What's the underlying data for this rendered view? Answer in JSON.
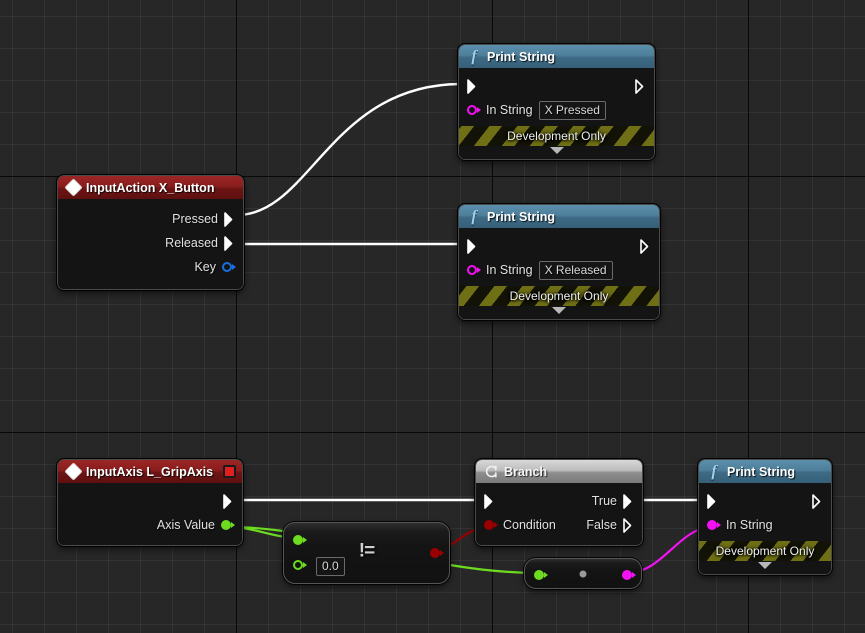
{
  "app": {
    "context": "unreal-engine-blueprint-event-graph",
    "canvas_bg": "#272727",
    "grid_minor": "#323232",
    "grid_major": "#000000"
  },
  "palette": {
    "exec_wire": "#ffffff",
    "string_pin": "#f312f3",
    "bool_pin": "#9b0000",
    "float_pin": "#6ddb20",
    "struct_pin": "#1a6fe0",
    "event_header": "#8a1d1d",
    "function_header": "#4e7f9b",
    "flow_header": "#bdbdbd",
    "dev_only_stripe": "#6f6f16"
  },
  "nodes": {
    "input_action": {
      "title": "InputAction X_Button",
      "icon": "event-diamond-icon",
      "pins": [
        {
          "label": "Pressed",
          "type": "exec",
          "dir": "out"
        },
        {
          "label": "Released",
          "type": "exec",
          "dir": "out"
        },
        {
          "label": "Key",
          "type": "struct",
          "dir": "out"
        }
      ]
    },
    "print_string_pressed": {
      "title": "Print String",
      "icon": "function-f-icon",
      "in_string_label": "In String",
      "in_string_value": "X Pressed",
      "footer": "Development Only"
    },
    "print_string_released": {
      "title": "Print String",
      "icon": "function-f-icon",
      "in_string_label": "In String",
      "in_string_value": "X Released",
      "footer": "Development Only"
    },
    "input_axis": {
      "title": "InputAxis L_GripAxis",
      "icon": "event-diamond-icon",
      "badge": "red-square-badge",
      "pins": [
        {
          "label": "",
          "type": "exec",
          "dir": "out"
        },
        {
          "label": "Axis Value",
          "type": "float",
          "dir": "out"
        }
      ]
    },
    "not_equal": {
      "glyph": "!=",
      "operation": "not-equal-float",
      "input_b_value": "0.0",
      "inputs": [
        {
          "type": "float",
          "connected": true
        },
        {
          "type": "float",
          "connected": false
        }
      ],
      "output": {
        "type": "bool"
      }
    },
    "branch": {
      "title": "Branch",
      "icon": "branch-flow-icon",
      "condition_label": "Condition",
      "true_label": "True",
      "false_label": "False"
    },
    "to_string": {
      "operation": "float-to-string-conversion",
      "input": {
        "type": "float"
      },
      "output": {
        "type": "string"
      }
    },
    "print_string_axis": {
      "title": "Print String",
      "icon": "function-f-icon",
      "in_string_label": "In String",
      "footer": "Development Only"
    }
  },
  "wires": [
    {
      "from": "input_action.Pressed",
      "to": "print_string_pressed.exec_in",
      "color": "#ffffff",
      "kind": "exec"
    },
    {
      "from": "input_action.Released",
      "to": "print_string_released.exec_in",
      "color": "#ffffff",
      "kind": "exec"
    },
    {
      "from": "input_axis.exec_out",
      "to": "branch.exec_in",
      "color": "#ffffff",
      "kind": "exec"
    },
    {
      "from": "input_axis.Axis Value",
      "to": "not_equal.input_a",
      "color": "#6ddb20",
      "kind": "float"
    },
    {
      "from": "input_axis.Axis Value",
      "to": "to_string.input",
      "color": "#6ddb20",
      "kind": "float"
    },
    {
      "from": "not_equal.output",
      "to": "branch.Condition",
      "color": "#9b0000",
      "kind": "bool"
    },
    {
      "from": "branch.True",
      "to": "print_string_axis.exec_in",
      "color": "#ffffff",
      "kind": "exec"
    },
    {
      "from": "to_string.output",
      "to": "print_string_axis.In String",
      "color": "#f312f3",
      "kind": "string"
    }
  ]
}
